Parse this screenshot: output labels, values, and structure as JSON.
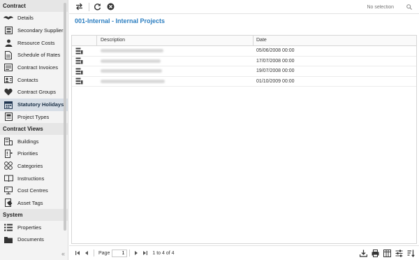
{
  "sidebar": {
    "sections": [
      {
        "header": "Contract",
        "items": [
          {
            "label": "Details",
            "icon": "mustache-icon"
          },
          {
            "label": "Secondary Suppliers",
            "icon": "suppliers-icon"
          },
          {
            "label": "Resource Costs",
            "icon": "person-icon"
          },
          {
            "label": "Schedule of Rates",
            "icon": "document-icon"
          },
          {
            "label": "Contract Invoices",
            "icon": "invoice-icon"
          },
          {
            "label": "Contacts",
            "icon": "contacts-icon"
          },
          {
            "label": "Contract Groups",
            "icon": "heart-icon"
          },
          {
            "label": "Statutory Holidays",
            "icon": "calendar-icon",
            "active": true
          },
          {
            "label": "Project Types",
            "icon": "project-icon"
          }
        ]
      },
      {
        "header": "Contract Views",
        "items": [
          {
            "label": "Buildings",
            "icon": "building-icon"
          },
          {
            "label": "Priorities",
            "icon": "priority-icon"
          },
          {
            "label": "Categories",
            "icon": "categories-icon"
          },
          {
            "label": "Instructions",
            "icon": "instructions-icon"
          },
          {
            "label": "Cost Centres",
            "icon": "cost-centre-icon"
          },
          {
            "label": "Asset Tags",
            "icon": "tag-icon"
          }
        ]
      },
      {
        "header": "System",
        "items": [
          {
            "label": "Properties",
            "icon": "list-icon"
          },
          {
            "label": "Documents",
            "icon": "folder-icon"
          }
        ]
      }
    ]
  },
  "toolbar": {
    "search_placeholder": "No selection"
  },
  "page_title": "001-Internal - Internal Projects",
  "grid": {
    "columns": [
      "Description",
      "Date"
    ],
    "rows": [
      {
        "date": "05/06/2008 00:00"
      },
      {
        "date": "17/07/2008 00:00"
      },
      {
        "date": "19/07/2008 00:00"
      },
      {
        "date": "01/10/2009 00:00"
      }
    ]
  },
  "pager": {
    "page_label": "Page",
    "page_value": "1",
    "range_text": "1 to 4 of 4"
  },
  "colors": {
    "accent": "#2d7fc1",
    "active_bg": "#d7dee6"
  }
}
